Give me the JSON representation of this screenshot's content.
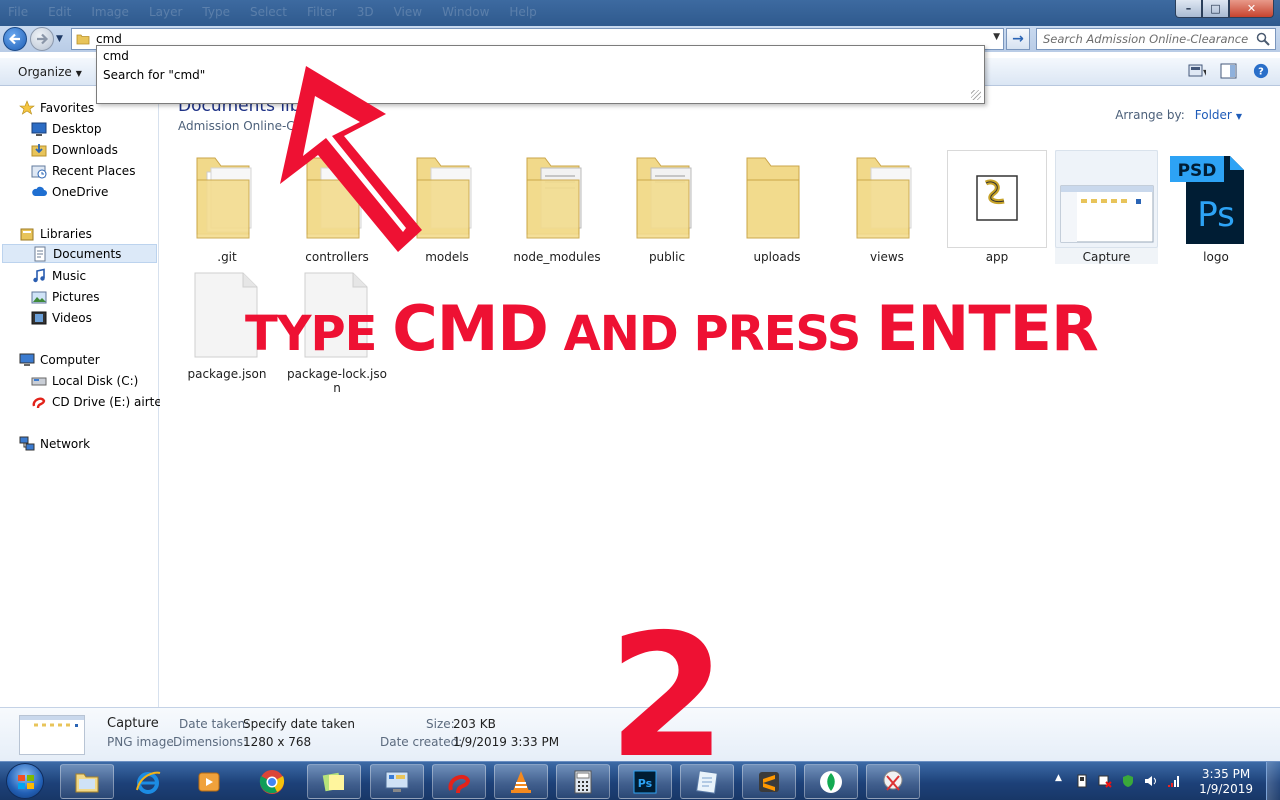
{
  "titlebar": {
    "ghost_menu": [
      "File",
      "Edit",
      "Image",
      "Layer",
      "Type",
      "Select",
      "Filter",
      "3D",
      "View",
      "Window",
      "Help"
    ],
    "minimize": "–",
    "maximize": "□",
    "close": "✕"
  },
  "address": {
    "value": "cmd",
    "go": "→"
  },
  "search": {
    "placeholder": "Search Admission Online-Clearance"
  },
  "autocomplete": {
    "items": [
      "cmd",
      "Search for \"cmd\""
    ]
  },
  "command_bar": {
    "organize": "Organize"
  },
  "nav": {
    "favorites": "Favorites",
    "favorites_items": [
      "Desktop",
      "Downloads",
      "Recent Places",
      "OneDrive"
    ],
    "libraries": "Libraries",
    "libraries_items": [
      "Documents",
      "Music",
      "Pictures",
      "Videos"
    ],
    "computer": "Computer",
    "computer_items": [
      "Local Disk (C:)",
      "CD Drive (E:) airtel"
    ],
    "network": "Network"
  },
  "content": {
    "library_title": "Documents library",
    "library_subtitle": "Admission Online-Clearance",
    "arrange_label": "Arrange by:",
    "arrange_value": "Folder",
    "items": [
      {
        "name": ".git",
        "type": "folder"
      },
      {
        "name": "controllers",
        "type": "folder"
      },
      {
        "name": "models",
        "type": "folder"
      },
      {
        "name": "node_modules",
        "type": "folder"
      },
      {
        "name": "public",
        "type": "folder"
      },
      {
        "name": "uploads",
        "type": "folder"
      },
      {
        "name": "views",
        "type": "folder"
      },
      {
        "name": "app",
        "type": "script"
      },
      {
        "name": "Capture",
        "type": "image"
      },
      {
        "name": "logo",
        "type": "psd"
      },
      {
        "name": "package.json",
        "type": "file"
      },
      {
        "name": "package-lock.json",
        "type": "file"
      }
    ]
  },
  "overlay": {
    "line_parts": [
      "TYPE ",
      "CMD",
      " AND PRESS ",
      "ENTER"
    ],
    "step_number": "2",
    "color": "#ee1133"
  },
  "details": {
    "name": "Capture",
    "type": "PNG image",
    "date_taken_label": "Date taken:",
    "date_taken_value": "Specify date taken",
    "dimensions_label": "Dimensions:",
    "dimensions_value": "1280 x 768",
    "size_label": "Size:",
    "size_value": "203 KB",
    "date_created_label": "Date created:",
    "date_created_value": "1/9/2019 3:33 PM"
  },
  "taskbar": {
    "apps": [
      "file-explorer",
      "internet-explorer",
      "media-player",
      "chrome",
      "sticky-notes",
      "control-panel",
      "airtel",
      "vlc",
      "calculator",
      "photoshop",
      "notepad",
      "sublime-text",
      "mongodb",
      "snipping-tool"
    ],
    "tray_arrow": "▲",
    "time": "3:35 PM",
    "date": "1/9/2019"
  }
}
